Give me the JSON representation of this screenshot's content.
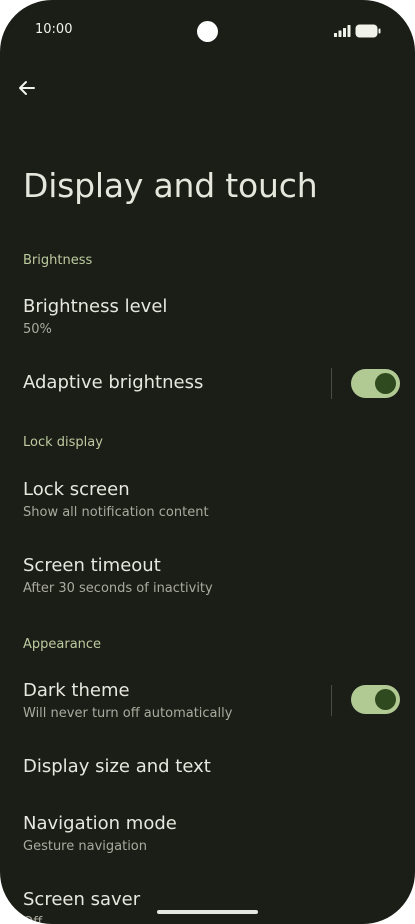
{
  "status_bar": {
    "time": "10:00",
    "icons": [
      "signal-icon",
      "battery-icon"
    ]
  },
  "header": {
    "back_icon": "arrow-back-icon",
    "title": "Display and touch"
  },
  "sections": {
    "brightness": {
      "header": "Brightness",
      "brightness_level": {
        "title": "Brightness level",
        "summary": "50%"
      },
      "adaptive_brightness": {
        "title": "Adaptive brightness",
        "enabled": true
      }
    },
    "lock_display": {
      "header": "Lock display",
      "lock_screen": {
        "title": "Lock screen",
        "summary": "Show all notification content"
      },
      "screen_timeout": {
        "title": "Screen timeout",
        "summary": "After 30 seconds of inactivity"
      }
    },
    "appearance": {
      "header": "Appearance",
      "dark_theme": {
        "title": "Dark theme",
        "summary": "Will never turn off automatically",
        "enabled": true
      },
      "display_size": {
        "title": "Display size and text"
      },
      "navigation_mode": {
        "title": "Navigation mode",
        "summary": "Gesture navigation"
      },
      "screen_saver": {
        "title": "Screen saver",
        "summary": "Off"
      }
    }
  },
  "colors": {
    "background": "#1b1d17",
    "accent": "#bccb9f",
    "switch_track": "#b1c993",
    "switch_thumb": "#2f4a1f"
  }
}
